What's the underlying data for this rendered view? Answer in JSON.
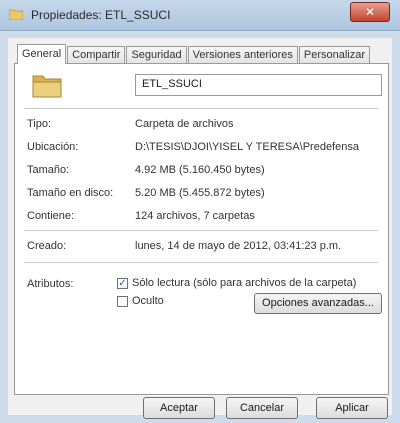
{
  "window": {
    "title": "Propiedades: ETL_SSUCI",
    "close_label": "✕"
  },
  "tabs": [
    {
      "label": "General"
    },
    {
      "label": "Compartir"
    },
    {
      "label": "Seguridad"
    },
    {
      "label": "Versiones anteriores"
    },
    {
      "label": "Personalizar"
    }
  ],
  "general": {
    "name_value": "ETL_SSUCI",
    "rows": [
      {
        "label": "Tipo:",
        "value": "Carpeta de archivos"
      },
      {
        "label": "Ubicación:",
        "value": "D:\\TESIS\\DJOI\\YISEL Y TERESA\\Predefensa"
      },
      {
        "label": "Tamaño:",
        "value": "4.92 MB (5.160.450 bytes)"
      },
      {
        "label": "Tamaño en disco:",
        "value": "5.20 MB (5.455.872 bytes)"
      },
      {
        "label": "Contiene:",
        "value": "124 archivos, 7 carpetas"
      },
      {
        "label": "Creado:",
        "value": "lunes, 14 de mayo de 2012, 03:41:23 p.m."
      }
    ],
    "attributes_label": "Atributos:",
    "readonly_label": "Sólo lectura (sólo para archivos de la carpeta)",
    "readonly_checked": true,
    "hidden_label": "Oculto",
    "hidden_checked": false,
    "advanced_label": "Opciones avanzadas..."
  },
  "buttons": {
    "accept": "Aceptar",
    "cancel": "Cancelar",
    "apply": "Aplicar"
  }
}
